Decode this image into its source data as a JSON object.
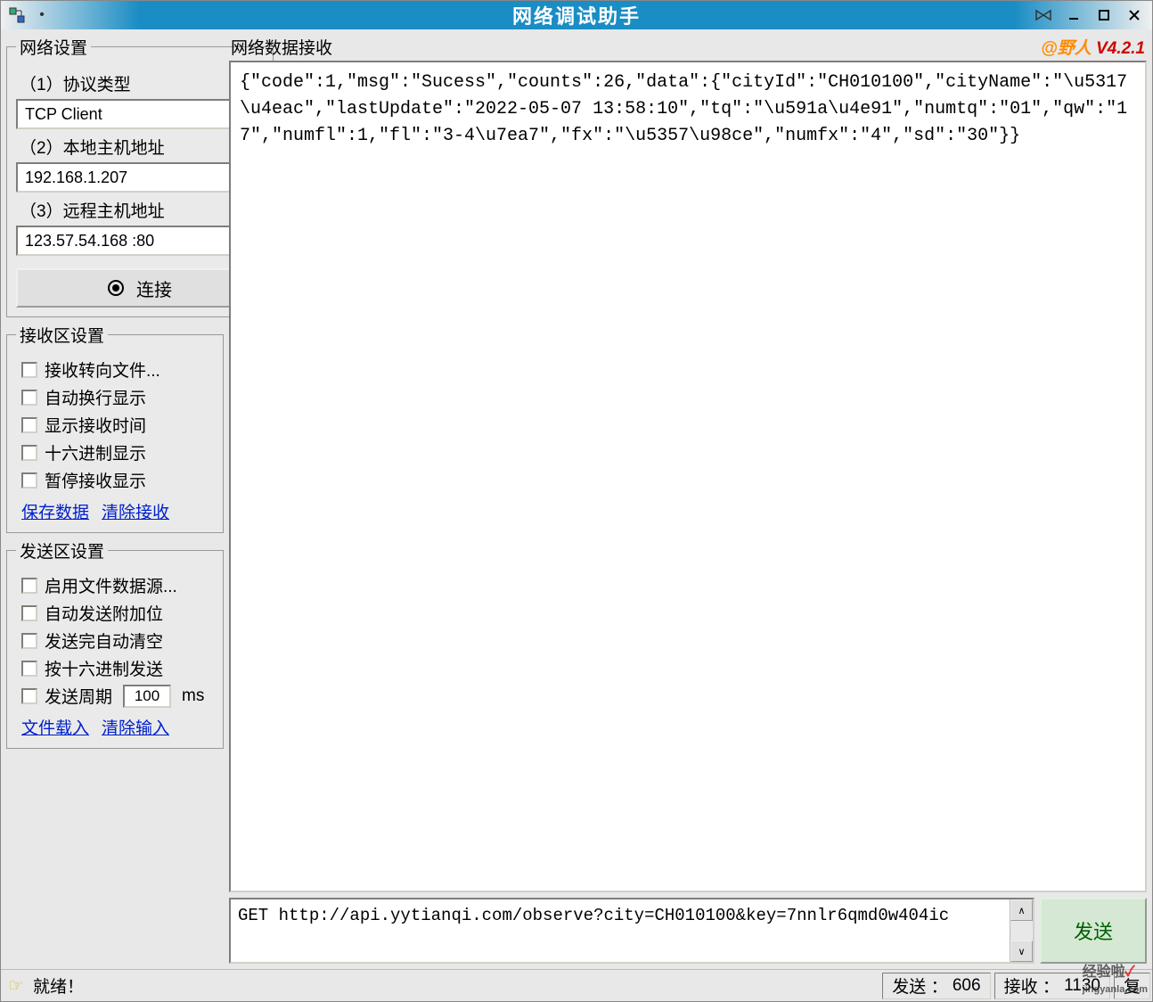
{
  "window": {
    "title": "网络调试助手"
  },
  "network": {
    "legend": "网络设置",
    "protocol_label": "（1）协议类型",
    "protocol_value": "TCP Client",
    "local_label": "（2）本地主机地址",
    "local_value": "192.168.1.207",
    "remote_label": "（3）远程主机地址",
    "remote_value": "123.57.54.168 :80",
    "connect_label": "连接"
  },
  "recv_settings": {
    "legend": "接收区设置",
    "opt_file": "接收转向文件...",
    "opt_wrap": "自动换行显示",
    "opt_time": "显示接收时间",
    "opt_hex": "十六进制显示",
    "opt_pause": "暂停接收显示",
    "save_link": "保存数据",
    "clear_link": "清除接收"
  },
  "send_settings": {
    "legend": "发送区设置",
    "opt_file": "启用文件数据源...",
    "opt_append": "自动发送附加位",
    "opt_clear": "发送完自动清空",
    "opt_hex": "按十六进制发送",
    "opt_period": "发送周期",
    "period_value": "100",
    "period_unit": "ms",
    "load_link": "文件载入",
    "clear_link": "清除输入"
  },
  "recv": {
    "title": "网络数据接收",
    "brand_at": "@野人",
    "brand_ver": "V4.2.1",
    "content": "{\"code\":1,\"msg\":\"Sucess\",\"counts\":26,\"data\":{\"cityId\":\"CH010100\",\"cityName\":\"\\u5317\\u4eac\",\"lastUpdate\":\"2022-05-07 13:58:10\",\"tq\":\"\\u591a\\u4e91\",\"numtq\":\"01\",\"qw\":\"17\",\"numfl\":1,\"fl\":\"3-4\\u7ea7\",\"fx\":\"\\u5357\\u98ce\",\"numfx\":\"4\",\"sd\":\"30\"}}"
  },
  "send": {
    "content": "GET http://api.yytianqi.com/observe?city=CH010100&key=7nnlr6qmd0w404ic",
    "button": "发送"
  },
  "status": {
    "ready": "就绪！",
    "send_label": "发送 ：",
    "send_count": "606",
    "recv_label": "接收 ：",
    "recv_count": "1130",
    "reset": "复"
  },
  "watermark": {
    "text": "经验啦",
    "check": "✓",
    "domain": "jingyanla.com"
  }
}
